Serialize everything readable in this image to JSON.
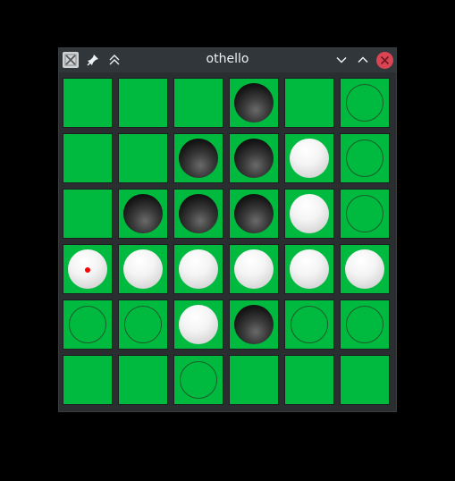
{
  "window": {
    "title": "othello"
  },
  "titlebar_buttons": {
    "app_icon": "othello-app-icon",
    "pin": "pin-icon",
    "keep_above": "keep-above-icon",
    "minimize": "chevron-down-icon",
    "maximize": "chevron-up-icon",
    "close": "close-icon"
  },
  "colors": {
    "board_green": "#00b93f",
    "close_red": "#da4453",
    "last_move_marker": "#ff0000"
  },
  "board": {
    "size": 6,
    "legend": {
      "B": "black",
      "W": "white",
      "H": "legal-move-hint",
      ".": "empty"
    },
    "rows": [
      [
        ".",
        ".",
        ".",
        "B",
        ".",
        "H"
      ],
      [
        ".",
        ".",
        "B",
        "B",
        "W",
        "H"
      ],
      [
        ".",
        "B",
        "B",
        "B",
        "W",
        "H"
      ],
      [
        "W",
        "W",
        "W",
        "W",
        "W",
        "W"
      ],
      [
        "H",
        "H",
        "W",
        "B",
        "H",
        "H"
      ],
      [
        ".",
        ".",
        "H",
        ".",
        ".",
        "."
      ]
    ],
    "last_move": {
      "row": 3,
      "col": 0
    }
  }
}
